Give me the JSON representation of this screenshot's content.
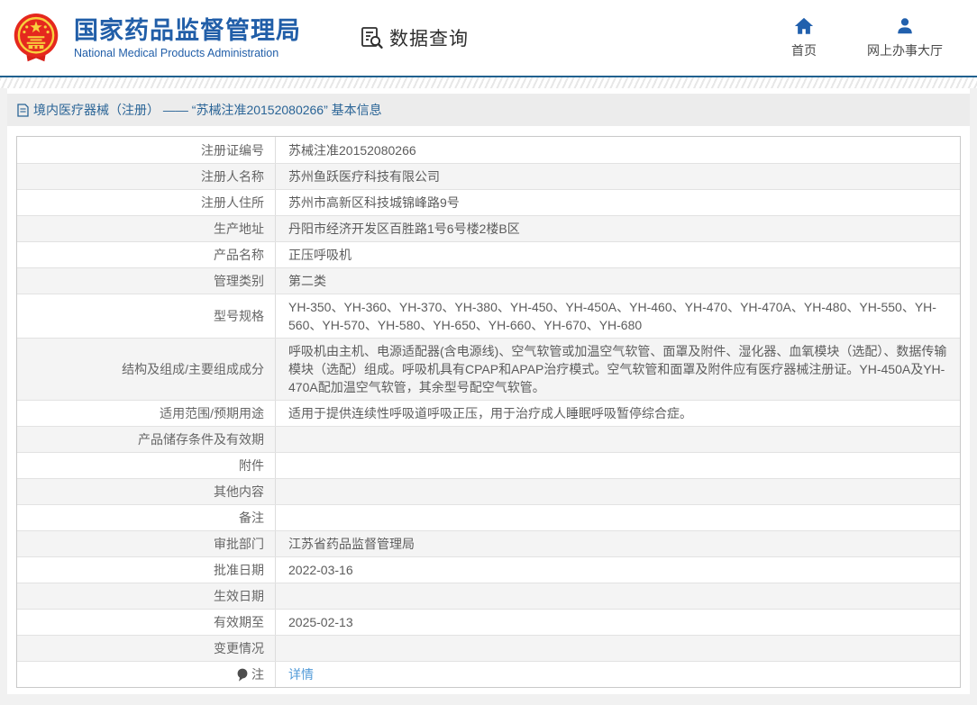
{
  "header": {
    "title": "国家药品监督管理局",
    "subtitle": "National Medical Products Administration",
    "data_query_label": "数据查询",
    "nav": [
      {
        "icon": "home-icon",
        "label": "首页"
      },
      {
        "icon": "user-icon",
        "label": "网上办事大厅"
      }
    ]
  },
  "breadcrumb": {
    "text": "境内医疗器械（注册） —— “苏械注准20152080266” 基本信息"
  },
  "table": {
    "rows": [
      {
        "label": "注册证编号",
        "value": "苏械注准20152080266"
      },
      {
        "label": "注册人名称",
        "value": "苏州鱼跃医疗科技有限公司"
      },
      {
        "label": "注册人住所",
        "value": "苏州市高新区科技城锦峰路9号"
      },
      {
        "label": "生产地址",
        "value": "丹阳市经济开发区百胜路1号6号楼2楼B区"
      },
      {
        "label": "产品名称",
        "value": "正压呼吸机"
      },
      {
        "label": "管理类别",
        "value": "第二类"
      },
      {
        "label": "型号规格",
        "value": "YH-350、YH-360、YH-370、YH-380、YH-450、YH-450A、YH-460、YH-470、YH-470A、YH-480、YH-550、YH-560、YH-570、YH-580、YH-650、YH-660、YH-670、YH-680"
      },
      {
        "label": "结构及组成/主要组成成分",
        "value": "呼吸机由主机、电源适配器(含电源线)、空气软管或加温空气软管、面罩及附件、湿化器、血氧模块（选配）、数据传输模块（选配）组成。呼吸机具有CPAP和APAP治疗模式。空气软管和面罩及附件应有医疗器械注册证。YH-450A及YH-470A配加温空气软管，其余型号配空气软管。"
      },
      {
        "label": "适用范围/预期用途",
        "value": "适用于提供连续性呼吸道呼吸正压，用于治疗成人睡眠呼吸暂停综合症。"
      },
      {
        "label": "产品储存条件及有效期",
        "value": ""
      },
      {
        "label": "附件",
        "value": ""
      },
      {
        "label": "其他内容",
        "value": ""
      },
      {
        "label": "备注",
        "value": ""
      },
      {
        "label": "审批部门",
        "value": "江苏省药品监督管理局"
      },
      {
        "label": "批准日期",
        "value": "2022-03-16"
      },
      {
        "label": "生效日期",
        "value": ""
      },
      {
        "label": "有效期至",
        "value": "2025-02-13"
      },
      {
        "label": "变更情况",
        "value": ""
      },
      {
        "label": "注",
        "label_icon": "note-balloon-icon",
        "value": "详情",
        "is_link": true
      }
    ]
  },
  "colors": {
    "brand_blue": "#215ea8",
    "icon_blue": "#2160ad",
    "link_blue": "#529bd8",
    "breadcrumb_text": "#2a6496",
    "stripe": "#f4f4f4",
    "divider_blue": "#20618f"
  }
}
